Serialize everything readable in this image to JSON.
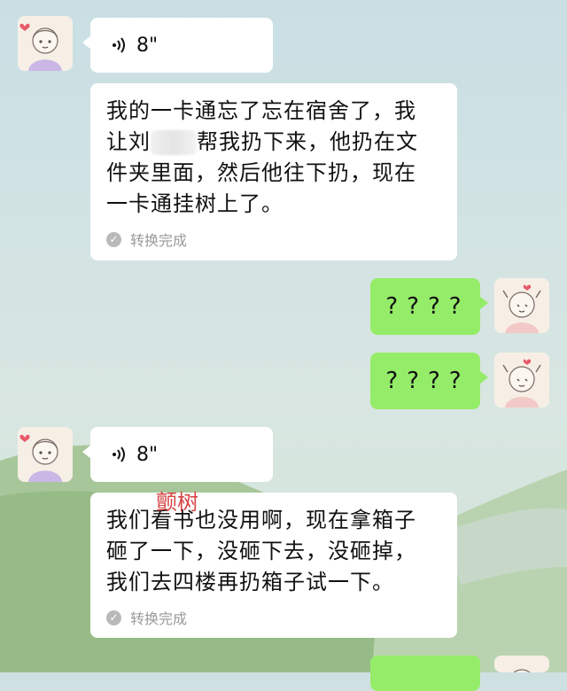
{
  "messages": {
    "voice1": {
      "duration": "8\""
    },
    "text1": {
      "line1": "我的一卡通忘了忘在宿舍了，我",
      "line2a": "让刘",
      "line2b": "帮我扔下来，他扔在文",
      "line3": "件夹里面，然后他往下扔，现在",
      "line4": "一卡通挂树上了。",
      "status": "转换完成"
    },
    "sent1": {
      "text": "????"
    },
    "sent2": {
      "text": "????"
    },
    "voice2": {
      "duration": "8\""
    },
    "text2": {
      "line1": "我们看书也没用啊，现在拿箱子",
      "line2": "砸了一下，没砸下去，没砸掉，",
      "line3": "我们去四楼再扔箱子试一下。",
      "status": "转换完成"
    }
  },
  "annotation": {
    "text": "颤树"
  },
  "icons": {
    "voice": "voice-wave-icon",
    "check": "check-circle-icon"
  },
  "colors": {
    "sent_bubble": "#95ec69",
    "received_bubble": "#ffffff",
    "annotation": "#d64545"
  }
}
